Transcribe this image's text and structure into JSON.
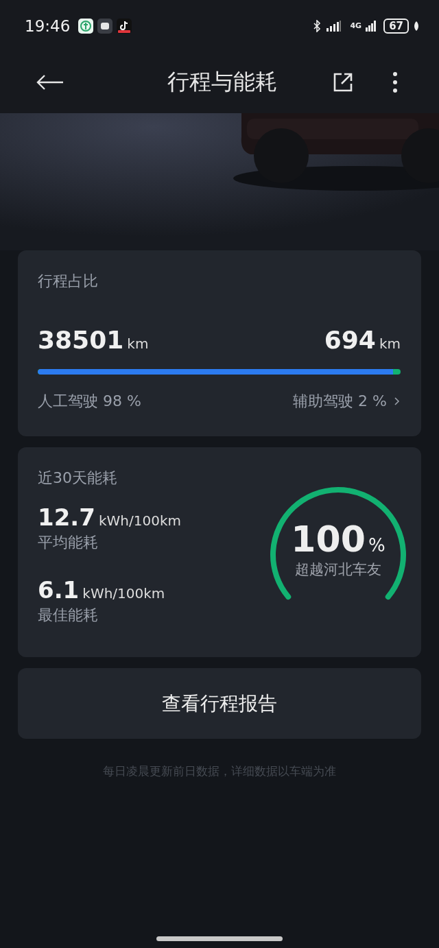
{
  "status_bar": {
    "time": "19:46",
    "network": "4G",
    "battery": "67"
  },
  "header": {
    "title": "行程与能耗"
  },
  "trip_share": {
    "title": "行程占比",
    "manual_value": "38501",
    "manual_unit": "km",
    "assisted_value": "694",
    "assisted_unit": "km",
    "level": 0.98,
    "manual_label": "人工驾驶 98 %",
    "assisted_label": "辅助驾驶 2 %"
  },
  "energy": {
    "title": "近30天能耗",
    "stats": [
      {
        "value": "12.7",
        "unit": "kWh/100km",
        "label": "平均能耗"
      },
      {
        "value": "6.1",
        "unit": "kWh/100km",
        "label": "最佳能耗"
      }
    ],
    "gauge": {
      "value": "100",
      "unit": "%",
      "label": "超越河北车友"
    }
  },
  "report_button": "查看行程报告",
  "footnote": "每日凌晨更新前日数据，详细数据以车端为准"
}
